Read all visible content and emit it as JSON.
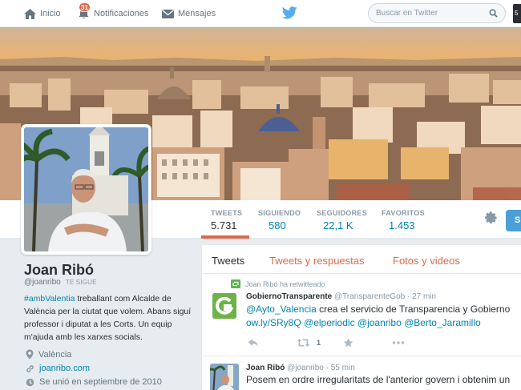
{
  "nav": {
    "home_label": "Inicio",
    "notifications_label": "Notificaciones",
    "notifications_badge": "31",
    "messages_label": "Mensajes",
    "account_initial": "5"
  },
  "search": {
    "placeholder": "Buscar en Twitter"
  },
  "stats": [
    {
      "label": "TWEETS",
      "value": "5.731"
    },
    {
      "label": "SIGUIENDO",
      "value": "580"
    },
    {
      "label": "SEGUIDORES",
      "value": "22,1 K"
    },
    {
      "label": "FAVORITOS",
      "value": "1.453"
    }
  ],
  "follow_button": "S",
  "profile": {
    "name": "Joan Ribó",
    "handle": "@joanribo",
    "follows_you": "TE SIGUE",
    "bio_hashtag": "#ambValentia",
    "bio_text": " treballant com Alcalde de València per la ciutat que volem. Abans siguí professor i diputat a les Corts. Un equip m'ajuda amb les xarxes socials.",
    "location": "València",
    "website": "joanribo.com",
    "joined": "Se unió en septiembre de 2010"
  },
  "tabs": [
    "Tweets",
    "Tweets y respuestas",
    "Fotos y videos"
  ],
  "tweets": [
    {
      "retweet_note": "Joan Ribó ha retwitteado",
      "author": "GobiernoTransparente",
      "handle": "@TransparenteGob",
      "time": "· 27 min",
      "line1_link": "@Ayto_Valencia",
      "line1_text": " crea el servicio de Transparencia y Gobierno",
      "line2_links": "ow.ly/SRy8Q @elperiodic @joanribo  @Berto_Jaramillo",
      "retweet_count": "1"
    },
    {
      "author": "Joan Ribó",
      "handle": "@joanribo",
      "time": "· 55 min",
      "text": "Posem en ordre irregularitats de l'anterior govern i obtenim un"
    }
  ],
  "colors": {
    "accent": "#e0684a",
    "link": "#0084b4",
    "follow": "#4a9fd8",
    "background": "#e6ecf0"
  }
}
